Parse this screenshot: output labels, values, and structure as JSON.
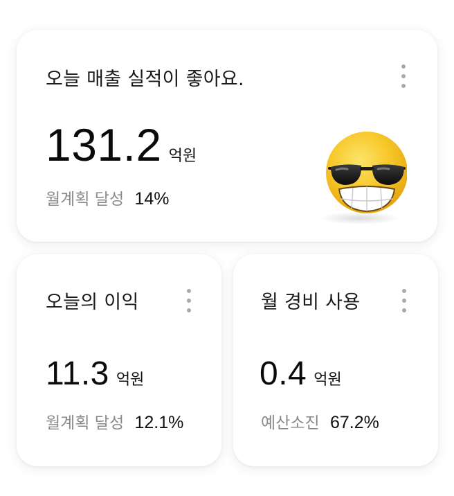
{
  "sales_card": {
    "title": "오늘 매출 실적이 좋아요.",
    "value": "131.2",
    "unit": "억원",
    "metric_label": "월계획 달성",
    "metric_value": "14%",
    "emoji": "sunglasses-grin-emoji"
  },
  "profit_card": {
    "title": "오늘의 이익",
    "value": "11.3",
    "unit": "억원",
    "metric_label": "월계획 달성",
    "metric_value": "12.1%"
  },
  "expense_card": {
    "title": "월 경비 사용",
    "value": "0.4",
    "unit": "억원",
    "metric_label": "예산소진",
    "metric_value": "67.2%"
  },
  "colors": {
    "card_background": "#ffffff",
    "secondary_text": "#8a8a8a",
    "kebab_dot": "#a9a9a9",
    "emoji_yellow": "#f7c82a"
  }
}
